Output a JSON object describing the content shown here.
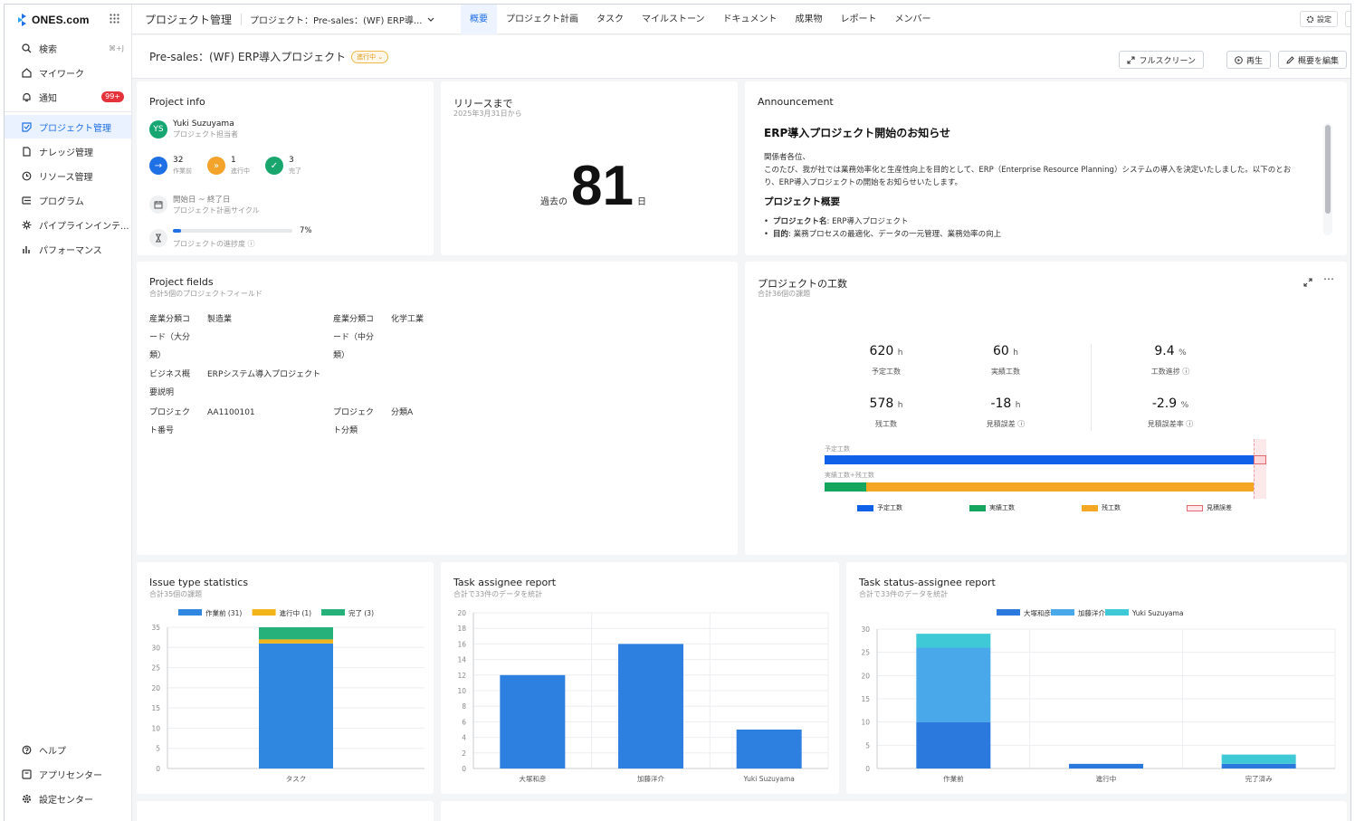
{
  "app": {
    "logo_text": "ONES.com"
  },
  "sidebar": {
    "search_label": "検索",
    "search_shortcut": "⌘+J",
    "items": [
      {
        "label": "マイワーク"
      },
      {
        "label": "通知",
        "badge": "99+"
      },
      {
        "label": "プロジェクト管理"
      },
      {
        "label": "ナレッジ管理"
      },
      {
        "label": "リソース管理"
      },
      {
        "label": "プログラム"
      },
      {
        "label": "パイプラインインテ..."
      },
      {
        "label": "パフォーマンス"
      }
    ],
    "bottom": [
      {
        "label": "ヘルプ"
      },
      {
        "label": "アプリセンター"
      },
      {
        "label": "設定センター"
      }
    ]
  },
  "topbar": {
    "module": "プロジェクト管理",
    "project": "プロジェクト：Pre-sales：(WF) ERP導...",
    "tabs": [
      "概要",
      "プロジェクト計画",
      "タスク",
      "マイルストーン",
      "ドキュメント",
      "成果物",
      "レポート",
      "メンバー"
    ],
    "active_tab": "概要",
    "settings": "設定"
  },
  "header": {
    "title": "Pre-sales：(WF) ERP導入プロジェクト",
    "status": "進行中",
    "fullscreen": "フルスクリーン",
    "play": "再生",
    "edit": "概要を編集"
  },
  "project_info": {
    "title": "Project info",
    "owner_initials": "YS",
    "owner_name": "Yuki Suzuyama",
    "owner_role": "プロジェクト担当者",
    "stats": [
      {
        "value": "32",
        "label": "作業前",
        "color": "#1f6fe5"
      },
      {
        "value": "1",
        "label": "進行中",
        "color": "#f3a32a"
      },
      {
        "value": "3",
        "label": "完了",
        "color": "#18a66c"
      }
    ],
    "date_label": "開始日 ~ 終了日",
    "cycle_label": "プロジェクト計画サイクル",
    "progress_value": "7%",
    "progress": 0.07,
    "progress_label": "プロジェクトの進捗度"
  },
  "release": {
    "title": "リリースまで",
    "sub": "2025年3月31日から",
    "prefix": "過去の",
    "days": "81",
    "suffix": "日"
  },
  "announcement": {
    "title": "Announcement",
    "heading": "ERP導入プロジェクト開始のお知らせ",
    "p1": "関係者各位、",
    "p2": "このたび、我が社では業務効率化と生産性向上を目的として、ERP（Enterprise Resource Planning）システムの導入を決定いたしました。以下のとおり、ERP導入プロジェクトの開始をお知らせいたします。",
    "h2": "プロジェクト概要",
    "li1_key": "プロジェクト名",
    "li1_val": ": ERP導入プロジェクト",
    "li2_key": "目的",
    "li2_val": ": 業務プロセスの最適化、データの一元管理、業務効率の向上"
  },
  "project_fields": {
    "title": "Project fields",
    "sub": "合計5個のプロジェクトフィールド",
    "fields": [
      {
        "label": "産業分類コード（大分類）",
        "value": "製造業"
      },
      {
        "label": "産業分類コード（中分類）",
        "value": "化学工業"
      },
      {
        "label": "ビジネス概要説明",
        "value": "ERPシステム導入プロジェクト"
      },
      {
        "label": "プロジェクト番号",
        "value": "AA1100101"
      },
      {
        "label": "プロジェクト分類",
        "value": "分類A"
      }
    ]
  },
  "workload": {
    "title": "プロジェクトの工数",
    "sub": "合計36個の課題",
    "metrics": [
      {
        "value": "620",
        "unit": "h",
        "label": "予定工数"
      },
      {
        "value": "60",
        "unit": "h",
        "label": "実績工数"
      },
      {
        "value": "9.4",
        "unit": "%",
        "label": "工数進捗"
      },
      {
        "value": "578",
        "unit": "h",
        "label": "残工数"
      },
      {
        "value": "-18",
        "unit": "h",
        "label": "見積誤差"
      },
      {
        "value": "-2.9",
        "unit": "%",
        "label": "見積誤差率"
      }
    ],
    "bar1_label": "予定工数",
    "bar2_label": "実績工数+残工数",
    "legend": [
      "予定工数",
      "実績工数",
      "残工数",
      "見積誤差"
    ],
    "colors": {
      "planned": "#0f62e8",
      "actual": "#14a55f",
      "remaining": "#f5a623",
      "error": "#f5b5b8"
    }
  },
  "issue_type": {
    "title": "Issue type statistics",
    "sub": "合計35個の課題",
    "chart_data": {
      "type": "bar",
      "stacked": true,
      "categories": [
        "タスク"
      ],
      "series": [
        {
          "name": "作業前 (31)",
          "values": [
            31
          ],
          "color": "#2f87e0"
        },
        {
          "name": "進行中 (1)",
          "values": [
            1
          ],
          "color": "#f2b418"
        },
        {
          "name": "完了 (3)",
          "values": [
            3
          ],
          "color": "#26b07a"
        }
      ],
      "ylim": [
        0,
        35
      ],
      "yticks": [
        0,
        5,
        10,
        15,
        20,
        25,
        30,
        35
      ],
      "legend": "top"
    }
  },
  "assignee": {
    "title": "Task assignee report",
    "sub": "合計で33件のデータを統計",
    "chart_data": {
      "type": "bar",
      "categories": [
        "大塚和彦",
        "加藤洋介",
        "Yuki Suzuyama"
      ],
      "values": [
        12,
        16,
        5
      ],
      "ylim": [
        0,
        20
      ],
      "yticks": [
        0,
        2,
        4,
        6,
        8,
        10,
        12,
        14,
        16,
        18,
        20
      ],
      "color": "#2d7fe0"
    }
  },
  "status_assignee": {
    "title": "Task status-assignee report",
    "sub": "合計で33件のデータを統計",
    "chart_data": {
      "type": "bar",
      "stacked": true,
      "categories": [
        "作業前",
        "進行中",
        "完了済み"
      ],
      "series": [
        {
          "name": "大塚和彦",
          "values": [
            10,
            1,
            1
          ],
          "color": "#2c79dd"
        },
        {
          "name": "加藤洋介",
          "values": [
            16,
            0,
            0
          ],
          "color": "#48a8ea"
        },
        {
          "name": "Yuki Suzuyama",
          "values": [
            3,
            0,
            2
          ],
          "color": "#3fc8d5"
        }
      ],
      "ylim": [
        0,
        30
      ],
      "yticks": [
        0,
        5,
        10,
        15,
        20,
        25,
        30
      ],
      "legend": "top"
    }
  }
}
